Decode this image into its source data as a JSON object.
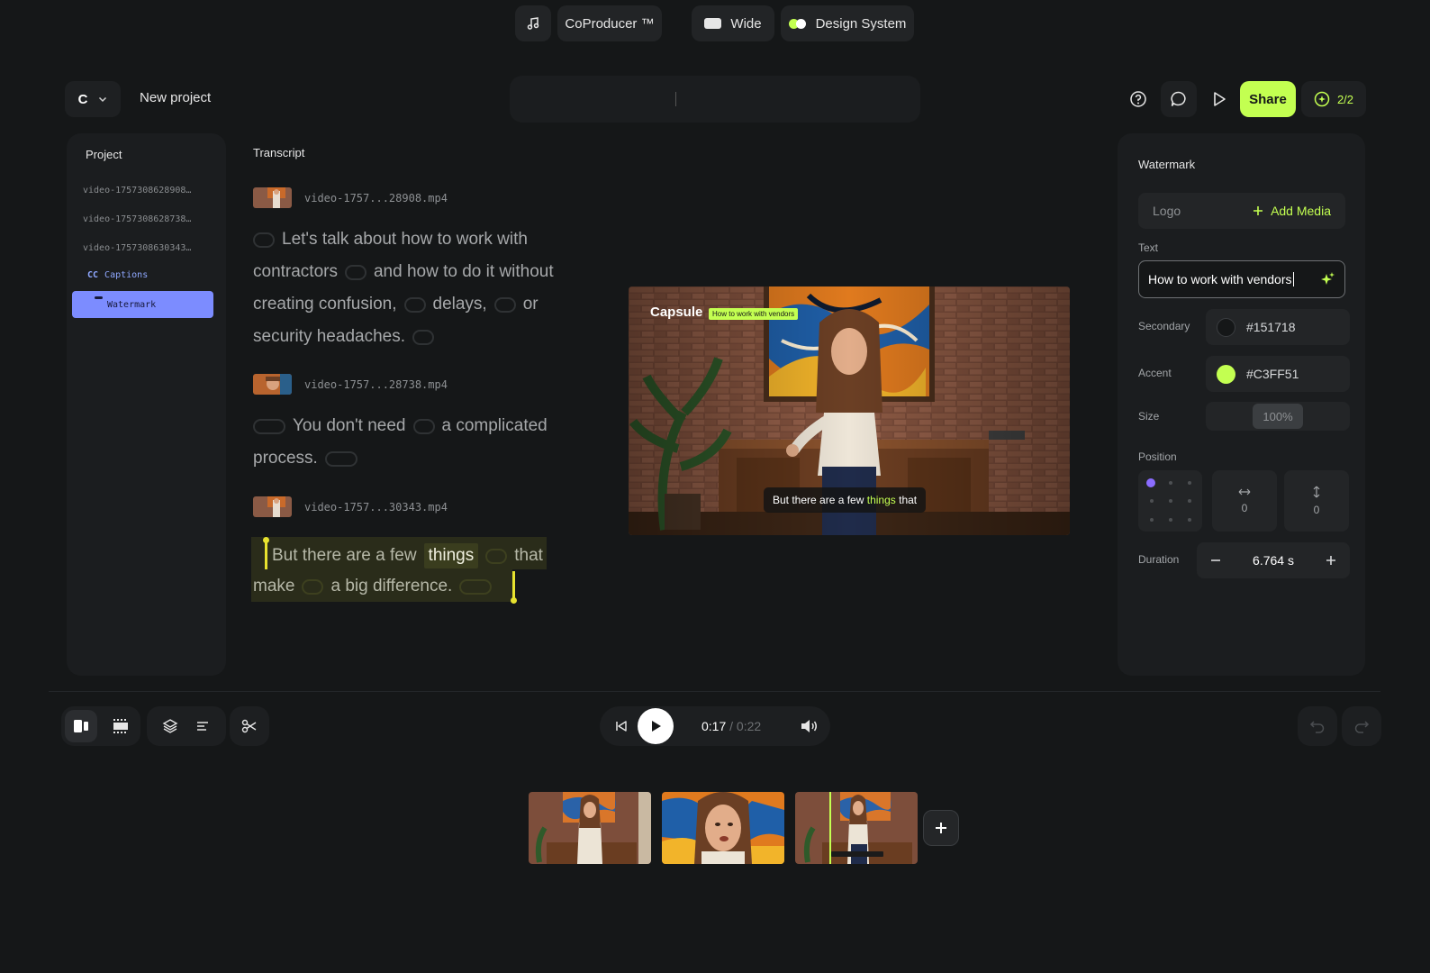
{
  "topbar": {
    "workspace_initial": "C",
    "project_title": "New project",
    "app_name": "CoProducer ™",
    "aspect": "Wide",
    "theme": "Design System",
    "share_label": "Share",
    "credits": "2/2"
  },
  "project_panel": {
    "title": "Project",
    "files": [
      "video-1757308628908…",
      "video-1757308628738…",
      "video-1757308630343…"
    ],
    "captions_label": "Captions",
    "captions_badge": "CC",
    "watermark_label": "Watermark"
  },
  "transcript": {
    "title": "Transcript",
    "clips": [
      {
        "file": "video-1757...28908.mp4"
      },
      {
        "file": "video-1757...28738.mp4"
      },
      {
        "file": "video-1757...30343.mp4"
      }
    ],
    "words": {
      "c1l1": "Let's talk about how to work with",
      "c1l2a": "contractors",
      "c1l2b": "and how to do it without",
      "c1l3a": "creating confusion,",
      "c1l3b": "delays,",
      "c1l3c": "or",
      "c1l4": "security headaches.",
      "c2l1a": "You don't need",
      "c2l1b": "a complicated",
      "c2l2": "process.",
      "c3l1a": "But there are a few",
      "c3l1b": "things",
      "c3l1c": "that",
      "c3l2a": "make",
      "c3l2b": "a big difference."
    }
  },
  "preview": {
    "brand": "Capsule",
    "brand_tag": "How to work with vendors",
    "subtitle_pre": "But there are a few",
    "subtitle_accent": "things",
    "subtitle_post": "that"
  },
  "watermark_panel": {
    "title": "Watermark",
    "logo_label": "Logo",
    "add_media": "Add Media",
    "text_label": "Text",
    "text_value": "How to work with vendors",
    "secondary_label": "Secondary",
    "secondary_color": "#151718",
    "accent_label": "Accent",
    "accent_color": "#C3FF51",
    "size_label": "Size",
    "size_value": "100%",
    "position_label": "Position",
    "pos_x": "0",
    "pos_y": "0",
    "duration_label": "Duration",
    "duration_value": "6.764 s"
  },
  "player": {
    "current": "0:17",
    "separator": "/",
    "total": "0:22"
  },
  "colors": {
    "accent": "#C3FF51",
    "background": "#151718",
    "selection": "#7c8cff",
    "position_dot": "#8a6cff"
  }
}
